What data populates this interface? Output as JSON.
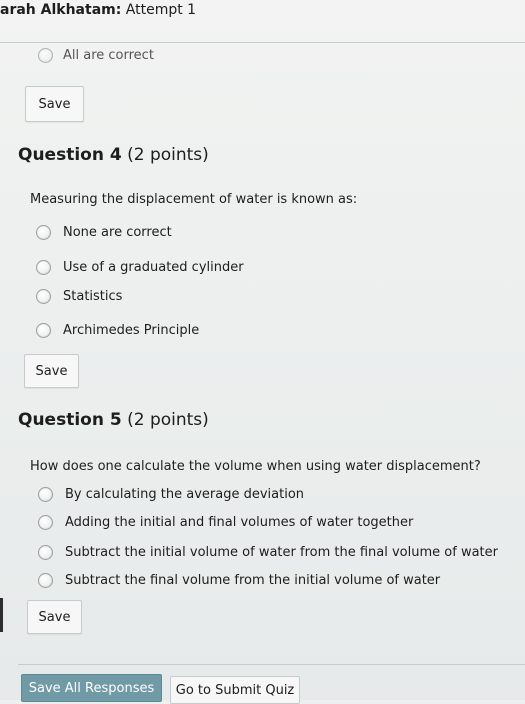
{
  "header": {
    "title_bold": "arah Alkhatam:",
    "title_rest": " Attempt 1"
  },
  "prev_question": {
    "cut_option_label": "All are correct"
  },
  "buttons": {
    "save_label": "Save",
    "save_all_label": "Save All Responses",
    "submit_label": "Go to Submit Quiz"
  },
  "questions": [
    {
      "label": "Question 4",
      "points": " (2 points)",
      "text": "Measuring the displacement of water is known as:",
      "options": [
        "None are correct",
        "Use of a graduated cylinder",
        "Statistics",
        "Archimedes Principle"
      ]
    },
    {
      "label": "Question 5",
      "points": " (2 points)",
      "text": "How does one calculate the volume when using water displacement?",
      "options": [
        "By calculating the average deviation",
        "Adding the initial and final volumes of water together",
        "Subtract the initial volume of water from the final volume of water",
        "Subtract the final volume from the initial volume of water"
      ]
    }
  ],
  "colors": {
    "primary_button": "#6f9aa6",
    "page_background": "#eef0ef"
  }
}
